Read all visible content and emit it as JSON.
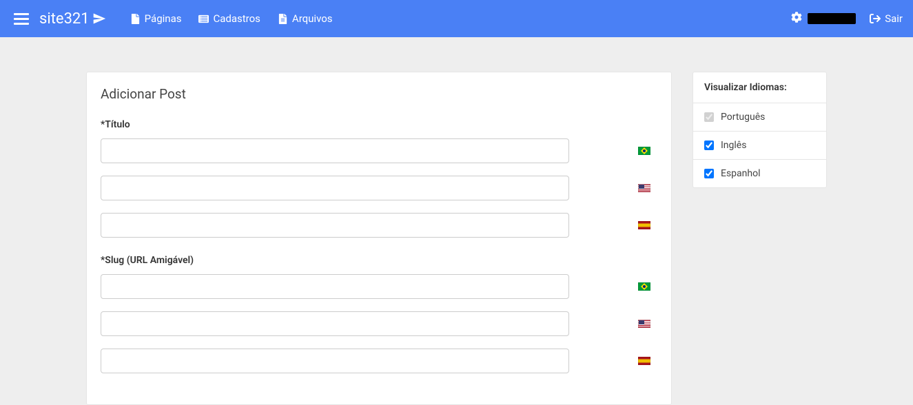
{
  "nav": {
    "logo": "site321",
    "links": {
      "pages": "Páginas",
      "registers": "Cadastros",
      "files": "Arquivos"
    },
    "logout": "Sair"
  },
  "panel": {
    "title": "Adicionar Post",
    "fields": {
      "title_label": "*Título",
      "slug_label": "*Slug (URL Amigável)",
      "title_pt": "",
      "title_en": "",
      "title_es": "",
      "slug_pt": "",
      "slug_en": "",
      "slug_es": ""
    }
  },
  "sidebar": {
    "title": "Visualizar Idiomas:",
    "languages": {
      "pt": {
        "label": "Português",
        "checked": true,
        "disabled": true
      },
      "en": {
        "label": "Inglês",
        "checked": true,
        "disabled": false
      },
      "es": {
        "label": "Espanhol",
        "checked": true,
        "disabled": false
      }
    }
  }
}
